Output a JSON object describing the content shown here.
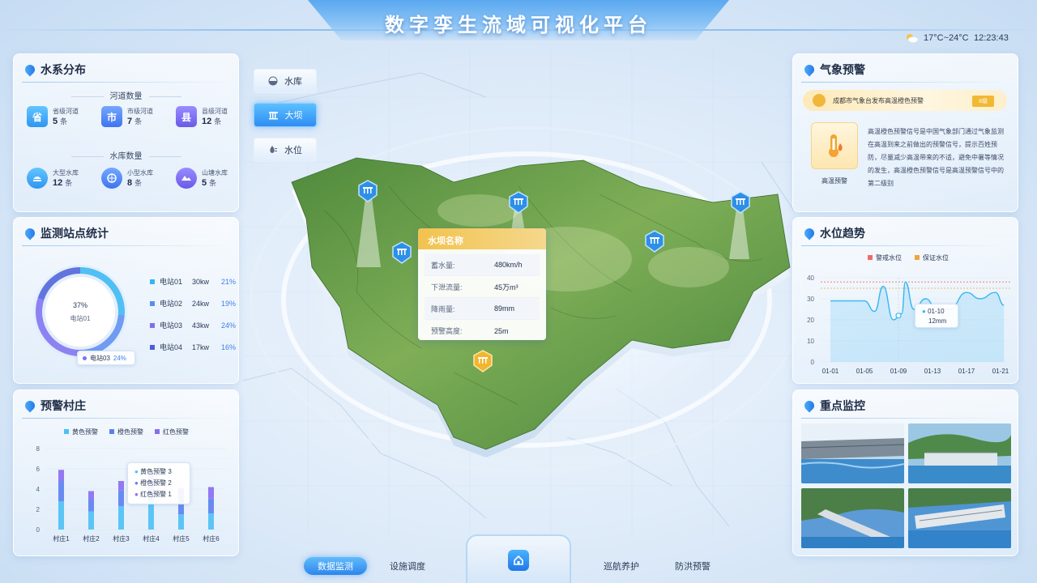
{
  "header": {
    "title": "数字孪生流域可视化平台",
    "temperature": "17°C~24°C",
    "time": "12:23:43"
  },
  "water_system": {
    "title": "水系分布",
    "river_section": "河道数量",
    "reservoir_section": "水库数量",
    "unit": "条",
    "rivers": [
      {
        "icon": "省",
        "label": "省级河道",
        "value": "5"
      },
      {
        "icon": "市",
        "label": "市级河道",
        "value": "7"
      },
      {
        "icon": "县",
        "label": "县级河道",
        "value": "12"
      }
    ],
    "reservoirs": [
      {
        "icon": "large-reservoir-icon",
        "label": "大型水库",
        "value": "12"
      },
      {
        "icon": "small-reservoir-icon",
        "label": "小型水库",
        "value": "8"
      },
      {
        "icon": "pond-reservoir-icon",
        "label": "山塘水库",
        "value": "5"
      }
    ]
  },
  "stations": {
    "title": "监测站点统计",
    "ring_center_pct": "37%",
    "ring_center_label": "电站01",
    "ring_tooltip_label": "电站03",
    "ring_tooltip_pct": "24%",
    "items": [
      {
        "name": "电站01",
        "kw": "30kw",
        "pct": "21%",
        "color": "#36b6f2"
      },
      {
        "name": "电站02",
        "kw": "24kw",
        "pct": "19%",
        "color": "#5b8cf0"
      },
      {
        "name": "电站03",
        "kw": "43kw",
        "pct": "24%",
        "color": "#7d6ff0"
      },
      {
        "name": "电站04",
        "kw": "17kw",
        "pct": "16%",
        "color": "#4a5ed8"
      }
    ]
  },
  "village_alert": {
    "title": "预警村庄",
    "legend": [
      "黄色预警",
      "橙色预警",
      "红色预警"
    ],
    "legend_colors": [
      "#4cc0f5",
      "#5b7ff0",
      "#8a6cf0"
    ],
    "tooltip": [
      {
        "label": "黄色预警",
        "value": "3"
      },
      {
        "label": "橙色预警",
        "value": "2"
      },
      {
        "label": "红色预警",
        "value": "1"
      }
    ]
  },
  "side_buttons": [
    {
      "label": "水库",
      "icon": "reservoir-icon",
      "active": false
    },
    {
      "label": "大坝",
      "icon": "dam-icon",
      "active": true
    },
    {
      "label": "水位",
      "icon": "water-level-icon",
      "active": false
    }
  ],
  "dam_card": {
    "title": "水坝名称",
    "rows": [
      {
        "key": "蓄水量:",
        "value": "480km/h"
      },
      {
        "key": "下泄流量:",
        "value": "45万m³"
      },
      {
        "key": "降雨量:",
        "value": "89mm"
      },
      {
        "key": "预警高度:",
        "value": "25m"
      }
    ]
  },
  "weather_alert": {
    "title": "气象预警",
    "banner": "成都市气象台发布高温橙色预警",
    "level": "II级",
    "box_label": "高温预警",
    "text": "高温橙色预警信号是中国气象部门通过气象监测在高温到来之前做出的预警信号，提示百姓预防，尽量减少高温带来的不适，避免中暑等情况的发生，高温橙色预警信号是高温预警信号中的第二级别"
  },
  "water_level": {
    "title": "水位趋势",
    "legend": [
      "警戒水位",
      "保证水位"
    ],
    "legend_colors": [
      "#f06a6a",
      "#f2a43a"
    ],
    "tooltip_date": "01-10",
    "tooltip_value": "12mm"
  },
  "monitoring": {
    "title": "重点监控"
  },
  "bottom_nav": [
    {
      "label": "数据监测",
      "active": true
    },
    {
      "label": "设施调度",
      "active": false
    },
    {
      "label": "巡航养护",
      "active": false
    },
    {
      "label": "防洪预警",
      "active": false
    }
  ],
  "chart_data": [
    {
      "type": "bar",
      "title": "预警村庄",
      "categories": [
        "村庄1",
        "村庄2",
        "村庄3",
        "村庄4",
        "村庄5",
        "村庄6"
      ],
      "ylim": [
        0,
        8
      ],
      "yticks": [
        0,
        2,
        4,
        6,
        8
      ],
      "series": [
        {
          "name": "黄色预警",
          "values": [
            2.8,
            1.8,
            2.3,
            3.0,
            1.5,
            1.6
          ]
        },
        {
          "name": "橙色预警",
          "values": [
            2.0,
            1.2,
            1.6,
            1.3,
            1.8,
            1.5
          ]
        },
        {
          "name": "红色预警",
          "values": [
            1.1,
            0.8,
            0.9,
            1.4,
            0.8,
            1.1
          ]
        }
      ]
    },
    {
      "type": "line",
      "title": "水位趋势",
      "x": [
        "01-01",
        "01-05",
        "01-09",
        "01-13",
        "01-17",
        "01-21"
      ],
      "ylim": [
        0,
        40
      ],
      "yticks": [
        0,
        10,
        20,
        30,
        40
      ],
      "series": [
        {
          "name": "水位",
          "points": [
            [
              0,
              29
            ],
            [
              1.0,
              29
            ],
            [
              1.3,
              24
            ],
            [
              1.55,
              36
            ],
            [
              1.85,
              20
            ],
            [
              2.1,
              23
            ],
            [
              2.2,
              38
            ],
            [
              2.45,
              25
            ],
            [
              2.8,
              30
            ],
            [
              3.1,
              26
            ],
            [
              3.5,
              25
            ],
            [
              4.0,
              33
            ],
            [
              4.4,
              30
            ],
            [
              4.85,
              33
            ],
            [
              5.1,
              27
            ]
          ]
        },
        {
          "name": "警戒水位",
          "values": [
            38,
            38,
            38,
            38,
            38,
            38
          ]
        },
        {
          "name": "保证水位",
          "values": [
            35,
            35,
            35,
            35,
            35,
            35
          ]
        }
      ]
    },
    {
      "type": "pie",
      "title": "监测站点统计",
      "categories": [
        "电站01",
        "电站02",
        "电站03",
        "电站04"
      ],
      "values": [
        21,
        19,
        24,
        16
      ]
    }
  ]
}
